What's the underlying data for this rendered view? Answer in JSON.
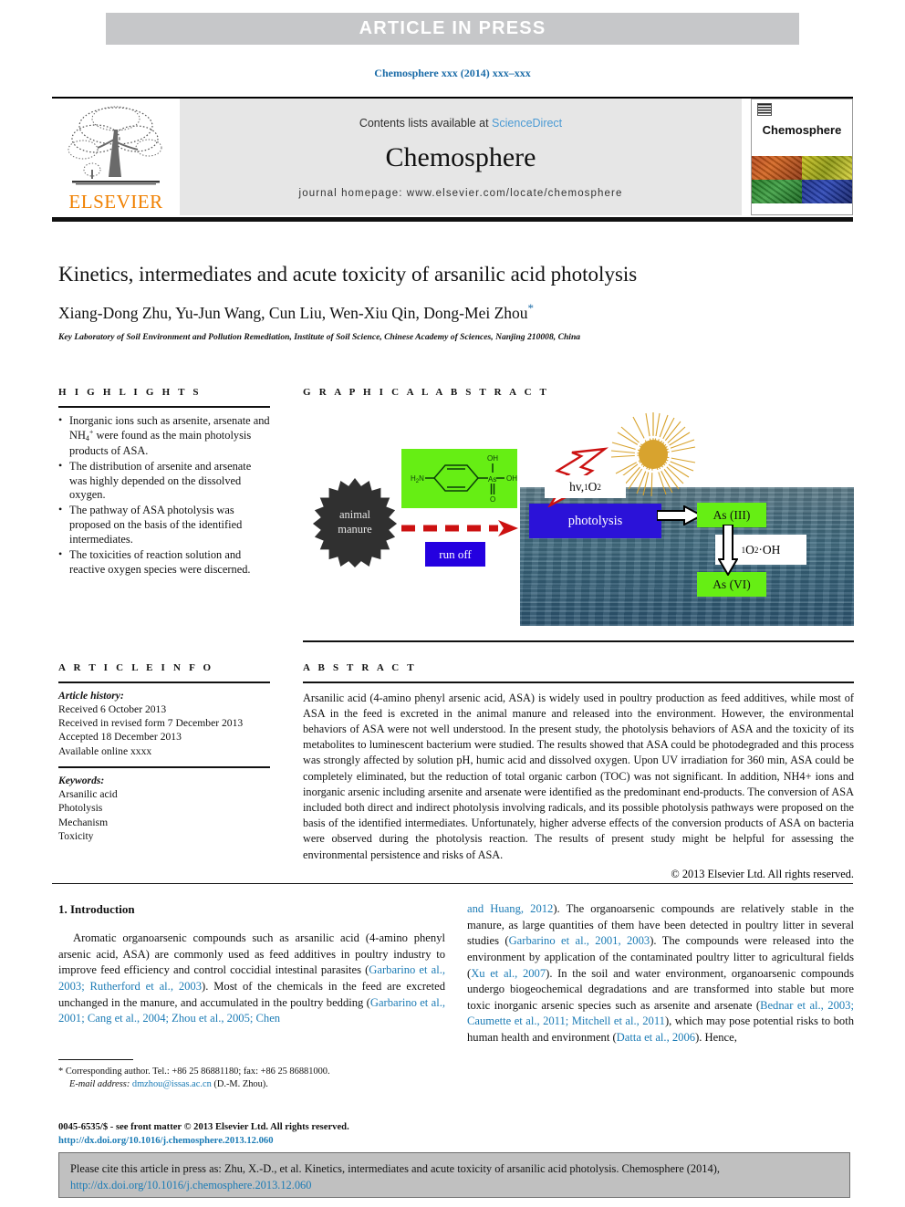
{
  "banner": {
    "text": "ARTICLE  IN  PRESS"
  },
  "runhead": {
    "text": "Chemosphere xxx (2014) xxx–xxx"
  },
  "masthead": {
    "elsevier_wordmark": "ELSEVIER",
    "contents_prefix": "Contents lists available at ",
    "sciencedirect": "ScienceDirect",
    "journal_name": "Chemosphere",
    "homepage": "journal homepage: www.elsevier.com/locate/chemosphere",
    "cover_title": "Chemosphere"
  },
  "article": {
    "title": "Kinetics, intermediates and acute toxicity of arsanilic acid photolysis",
    "authors": "Xiang-Dong Zhu, Yu-Jun Wang, Cun Liu, Wen-Xiu Qin, Dong-Mei Zhou",
    "corresponding_marker": "*",
    "affiliation": "Key Laboratory of Soil Environment and Pollution Remediation, Institute of Soil Science, Chinese Academy of Sciences, Nanjing 210008, China"
  },
  "highlights": {
    "heading": "H I G H L I G H T S",
    "items": [
      "Inorganic ions such as arsenite, arsenate and NH4+ were found as the main photolysis products of ASA.",
      "The distribution of arsenite and arsenate was highly depended on the dissolved oxygen.",
      "The pathway of ASA photolysis was proposed on the basis of the identified intermediates.",
      "The toxicities of reaction solution and reactive oxygen species were discerned."
    ]
  },
  "graphical_abstract": {
    "heading": "G R A P H I C A L   A B S T R A C T",
    "labels": {
      "animal_manure_line1": "animal",
      "animal_manure_line2": "manure",
      "run_off": "run off",
      "photolysis": "photolysis",
      "as_iii": "As (III)",
      "as_vi": "As (VI)",
      "hv_label_a": "hv, ",
      "hv_label_b": "1",
      "hv_label_c": "O",
      "hv_label_d": "2",
      "ros_label_a": "1",
      "ros_label_b": "O",
      "ros_label_c": "2",
      "ros_label_d": " ·OH",
      "molecule_nh2": "H2N",
      "molecule_as": "As",
      "molecule_oh_top": "OH",
      "molecule_oh_right": "OH",
      "molecule_o": "O"
    },
    "colors": {
      "green_box": "#66ee14",
      "blue_box": "#2b12d8",
      "starburst": "#303030",
      "red_arrow": "#cc1111",
      "sun": "#d8a32e"
    }
  },
  "article_info": {
    "heading": "A R T I C L E   I N F O",
    "history_label": "Article history:",
    "history": [
      "Received 6 October 2013",
      "Received in revised form 7 December 2013",
      "Accepted 18 December 2013",
      "Available online xxxx"
    ],
    "keywords_label": "Keywords:",
    "keywords": [
      "Arsanilic acid",
      "Photolysis",
      "Mechanism",
      "Toxicity"
    ]
  },
  "abstract": {
    "heading": "A B S T R A C T",
    "text": "Arsanilic acid (4-amino phenyl arsenic acid, ASA) is widely used in poultry production as feed additives, while most of ASA in the feed is excreted in the animal manure and released into the environment. However, the environmental behaviors of ASA were not well understood. In the present study, the photolysis behaviors of ASA and the toxicity of its metabolites to luminescent bacterium were studied. The results showed that ASA could be photodegraded and this process was strongly affected by solution pH, humic acid and dissolved oxygen. Upon UV irradiation for 360 min, ASA could be completely eliminated, but the reduction of total organic carbon (TOC) was not significant. In addition, NH4+ ions and inorganic arsenic including arsenite and arsenate were identified as the predominant end-products. The conversion of ASA included both direct and indirect photolysis involving radicals, and its possible photolysis pathways were proposed on the basis of the identified intermediates. Unfortunately, higher adverse effects of the conversion products of ASA on bacteria were observed during the photolysis reaction. The results of present study might be helpful for assessing the environmental persistence and risks of ASA.",
    "copyright": "© 2013 Elsevier Ltd. All rights reserved."
  },
  "introduction": {
    "heading": "1. Introduction",
    "left_paragraph_parts": [
      "Aromatic organoarsenic compounds such as arsanilic acid (4-amino phenyl arsenic acid, ASA) are commonly used as feed additives in poultry industry to improve feed efficiency and control coccidial intestinal parasites (",
      "Garbarino et al., 2003; Rutherford et al., 2003",
      "). Most of the chemicals in the feed are excreted unchanged in the manure, and accumulated in the poultry bedding (",
      "Garbarino et al., 2001; Cang et al., 2004; Zhou et al., 2005; Chen",
      ""
    ],
    "right_paragraph_parts": [
      "",
      "and Huang, 2012",
      "). The organoarsenic compounds are relatively stable in the manure, as large quantities of them have been detected in poultry litter in several studies (",
      "Garbarino et al., 2001, 2003",
      "). The compounds were released into the environment by application of the contaminated poultry litter to agricultural fields (",
      "Xu et al., 2007",
      "). In the soil and water environment, organoarsenic compounds undergo biogeochemical degradations and are transformed into stable but more toxic inorganic arsenic species such as arsenite and arsenate (",
      "Bednar et al., 2003; Caumette et al., 2011; Mitchell et al., 2011",
      "), which may pose potential risks to both human health and environment (",
      "Datta et al., 2006",
      "). Hence,"
    ]
  },
  "footnote": {
    "marker": "*",
    "corresponding": "Corresponding author. Tel.: +86 25 86881180; fax: +86 25 86881000.",
    "email_label": "E-mail address:",
    "email": "dmzhou@issas.ac.cn",
    "email_suffix": "(D.-M. Zhou)."
  },
  "issn_line": {
    "text": "0045-6535/$ - see front matter © 2013 Elsevier Ltd. All rights reserved.",
    "doi": "http://dx.doi.org/10.1016/j.chemosphere.2013.12.060"
  },
  "cite_box": {
    "text": "Please cite this article in press as: Zhu, X.-D., et al. Kinetics, intermediates and acute toxicity of arsanilic acid photolysis. Chemosphere (2014), ",
    "doi_a": "http://",
    "doi_b": "dx.doi.org/10.1016/j.chemosphere.2013.12.060"
  }
}
